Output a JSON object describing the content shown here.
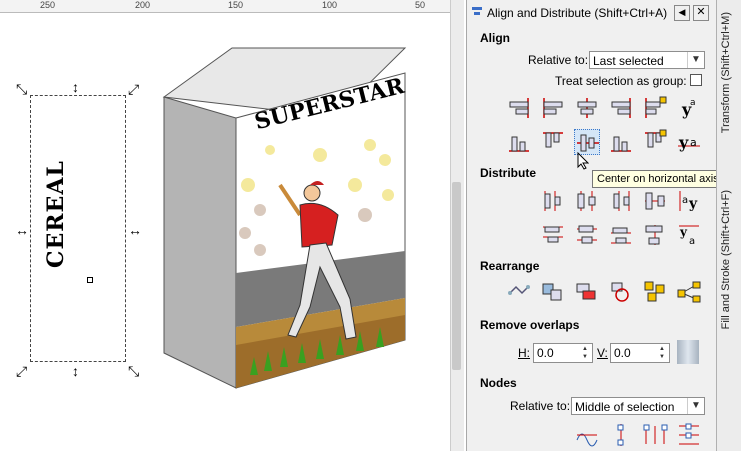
{
  "ruler": {
    "ticks": [
      "250",
      "200",
      "150",
      "100",
      "50"
    ]
  },
  "canvas": {
    "side_text": "CEREAL",
    "front_title": "SUPERSTAR"
  },
  "panel": {
    "title": "Align and Distribute (Shift+Ctrl+A)",
    "align": {
      "heading": "Align",
      "relative_label": "Relative to:",
      "relative_value": "Last selected",
      "group_label": "Treat selection as group:"
    },
    "distribute": {
      "heading": "Distribute"
    },
    "rearrange": {
      "heading": "Rearrange"
    },
    "remove_overlaps": {
      "heading": "Remove overlaps",
      "h_label": "H:",
      "h_value": "0.0",
      "v_label": "V:",
      "v_value": "0.0"
    },
    "nodes": {
      "heading": "Nodes",
      "relative_label": "Relative to:",
      "relative_value": "Middle of selection"
    },
    "tooltip": "Center on horizontal axis"
  },
  "side_tabs": {
    "transform": "Transform (Shift+Ctrl+M)",
    "fill_stroke": "Fill and Stroke (Shift+Ctrl+F)"
  },
  "colors": {
    "accent": "#cc0000",
    "highlight": "#e8e8e8",
    "tooltip_bg": "#ffffe1"
  }
}
